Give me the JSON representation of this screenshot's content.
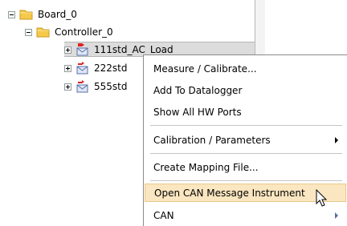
{
  "tree": {
    "root": {
      "label": "Board_0",
      "icon": "folder-icon"
    },
    "child": {
      "label": "Controller_0",
      "icon": "folder-icon"
    },
    "items": [
      {
        "label": "111std_AC_Load",
        "icon": "can-message-icon"
      },
      {
        "label": "222std",
        "icon": "can-message-icon"
      },
      {
        "label": "555std",
        "icon": "can-message-icon"
      }
    ]
  },
  "context_menu": {
    "items": [
      {
        "label": "Measure / Calibrate...",
        "submenu": false
      },
      {
        "label": "Add To Datalogger",
        "submenu": false
      },
      {
        "label": "Show All HW Ports",
        "submenu": false
      },
      {
        "label": "Calibration / Parameters",
        "submenu": true
      },
      {
        "label": "Create Mapping File...",
        "submenu": false
      },
      {
        "label": "Open CAN Message Instrument",
        "submenu": false,
        "highlighted": true
      },
      {
        "label": "CAN",
        "submenu": true
      }
    ]
  },
  "colors": {
    "highlight": "#fae6c0",
    "selection": "#dcdcdc",
    "folder": "#f7c94a"
  }
}
